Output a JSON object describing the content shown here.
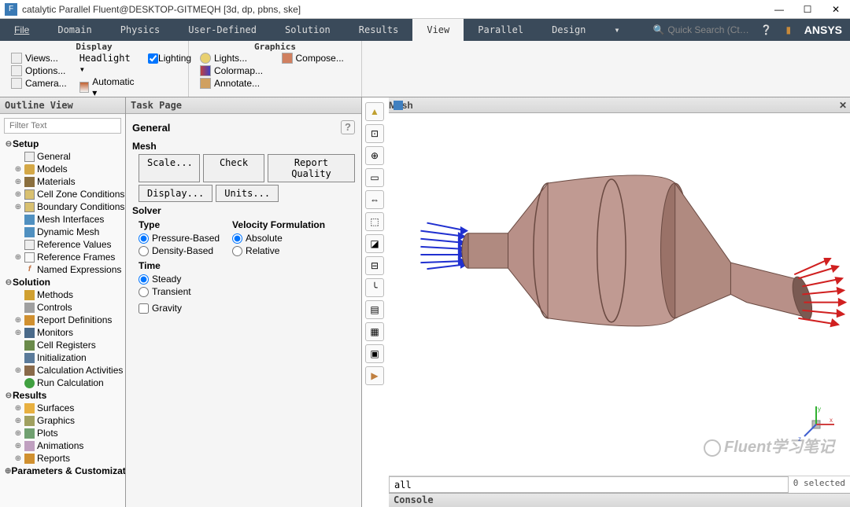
{
  "window": {
    "title": "catalytic Parallel Fluent@DESKTOP-GITMEQH  [3d, dp, pbns, ske]",
    "app_icon": "F"
  },
  "menu": {
    "items": [
      "File",
      "Domain",
      "Physics",
      "User-Defined",
      "Solution",
      "Results",
      "View",
      "Parallel",
      "Design"
    ],
    "active": "View",
    "search_placeholder": "Quick Search (Ct…",
    "brand": "ANSYS"
  },
  "ribbon": {
    "display": {
      "label": "Display",
      "items": [
        "Views...",
        "Options...",
        "Camera..."
      ],
      "col2": [
        "Headlight ▾",
        "Automatic ▾"
      ],
      "lighting": "Lighting"
    },
    "graphics": {
      "label": "Graphics",
      "col1": [
        "Lights...",
        "Colormap...",
        "Annotate..."
      ],
      "col2": [
        "Compose..."
      ]
    }
  },
  "outline": {
    "header": "Outline View",
    "filter_placeholder": "Filter Text",
    "tree": {
      "setup": "Setup",
      "general": "General",
      "models": "Models",
      "materials": "Materials",
      "cellzone": "Cell Zone Conditions",
      "boundary": "Boundary Conditions",
      "meshif": "Mesh Interfaces",
      "dynmesh": "Dynamic Mesh",
      "refval": "Reference Values",
      "refframes": "Reference Frames",
      "namedex": "Named Expressions",
      "solution": "Solution",
      "methods": "Methods",
      "controls": "Controls",
      "reportdef": "Report Definitions",
      "monitors": "Monitors",
      "cellreg": "Cell Registers",
      "init": "Initialization",
      "calcact": "Calculation Activities",
      "runcalc": "Run Calculation",
      "results": "Results",
      "surfaces": "Surfaces",
      "graphics": "Graphics",
      "plots": "Plots",
      "animations": "Animations",
      "reports": "Reports",
      "params": "Parameters & Customizat"
    }
  },
  "task": {
    "header": "Task Page",
    "title": "General",
    "mesh_label": "Mesh",
    "buttons": {
      "scale": "Scale...",
      "check": "Check",
      "report": "Report Quality",
      "display": "Display...",
      "units": "Units..."
    },
    "solver_label": "Solver",
    "type_label": "Type",
    "type_opts": [
      "Pressure-Based",
      "Density-Based"
    ],
    "vel_label": "Velocity Formulation",
    "vel_opts": [
      "Absolute",
      "Relative"
    ],
    "time_label": "Time",
    "time_opts": [
      "Steady",
      "Transient"
    ],
    "gravity": "Gravity"
  },
  "viewport": {
    "header": "Mesh",
    "cmd": "all",
    "selected": "0 selected",
    "console": "Console",
    "watermark": "Fluent学习笔记"
  }
}
